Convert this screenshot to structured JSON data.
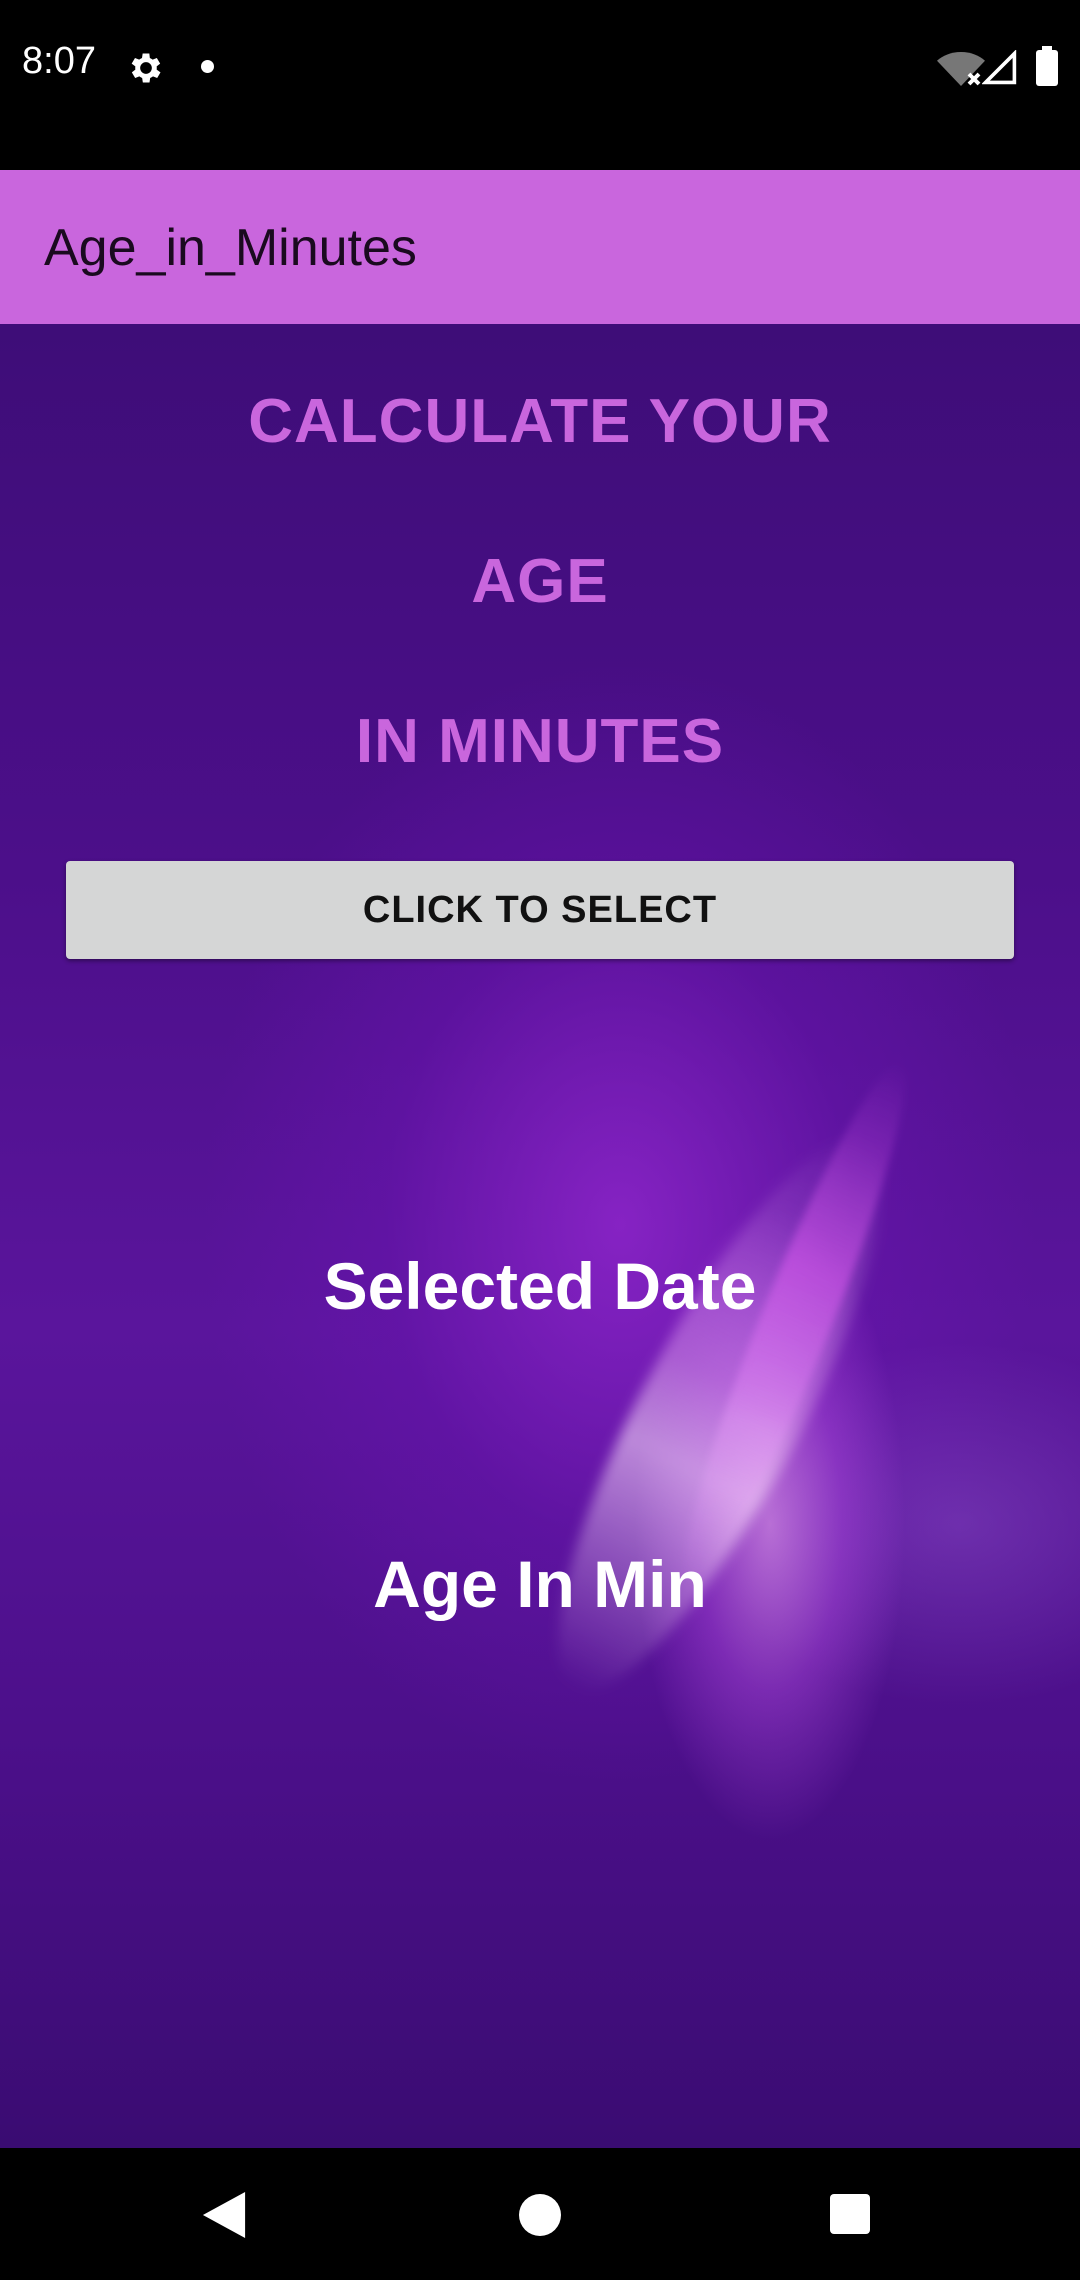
{
  "status_bar": {
    "time": "8:07",
    "icons": [
      "gear-icon",
      "notification-dot-icon",
      "wifi-off-icon",
      "cell-signal-icon",
      "battery-icon"
    ]
  },
  "app_bar": {
    "title": "Age_in_Minutes"
  },
  "main": {
    "headline_line1": "CALCULATE YOUR",
    "headline_line2": "AGE",
    "headline_line3": "IN MINUTES",
    "select_button_label": "CLICK TO SELECT",
    "selected_date_text": "Selected Date",
    "age_in_min_text": "Age In Min"
  },
  "nav_bar": {
    "icons": [
      "back-icon",
      "home-icon",
      "recents-icon"
    ]
  },
  "colors": {
    "app_bar": "#c966dd",
    "headline": "#c966dd",
    "button_bg": "#d5d6d6",
    "background_purple": "#4c0f8a",
    "result_text": "#ffffff"
  }
}
